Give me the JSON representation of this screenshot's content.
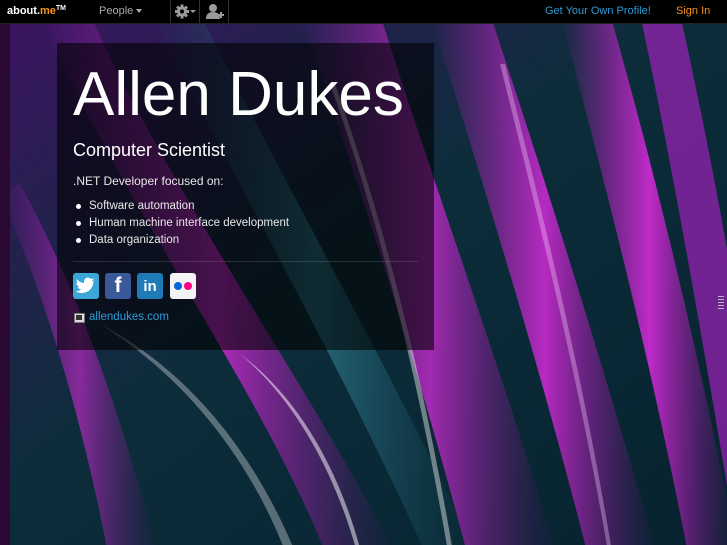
{
  "topbar": {
    "logo_text": "about.",
    "logo_accent": "me",
    "logo_tm": "TM",
    "people_label": "People",
    "get_profile_label": "Get Your Own Profile!",
    "sign_in_label": "Sign In"
  },
  "profile": {
    "name": "Allen Dukes",
    "headline": "Computer Scientist",
    "intro": ".NET Developer focused on:",
    "bullets": [
      "Software automation",
      "Human machine interface development",
      "Data organization"
    ],
    "social": {
      "twitter_glyph": "t",
      "facebook_glyph": "f",
      "linkedin_glyph": "in"
    },
    "website_label": "allendukes.com"
  },
  "colors": {
    "accent_orange": "#f7941d",
    "link_blue": "#2e9bd6",
    "background_purple": "#8b1fb0",
    "background_teal": "#0a3a48"
  }
}
